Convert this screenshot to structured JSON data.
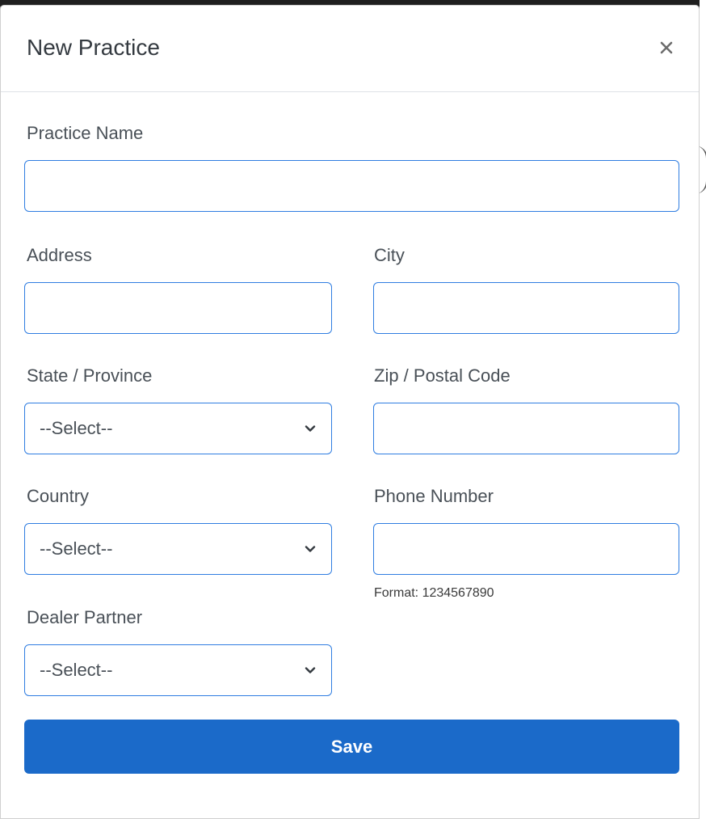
{
  "modal": {
    "title": "New Practice"
  },
  "fields": {
    "practice_name": {
      "label": "Practice Name",
      "value": "",
      "placeholder": ""
    },
    "address": {
      "label": "Address",
      "value": "",
      "placeholder": ""
    },
    "city": {
      "label": "City",
      "value": "",
      "placeholder": ""
    },
    "state": {
      "label": "State / Province",
      "selected": "--Select--"
    },
    "zip": {
      "label": "Zip / Postal Code",
      "value": "",
      "placeholder": ""
    },
    "country": {
      "label": "Country",
      "selected": "--Select--"
    },
    "phone": {
      "label": "Phone Number",
      "value": "",
      "placeholder": "",
      "hint": "Format: 1234567890"
    },
    "dealer": {
      "label": "Dealer Partner",
      "selected": "--Select--"
    }
  },
  "actions": {
    "save_label": "Save"
  },
  "colors": {
    "primary": "#1b6ac9",
    "input_border": "#2f7de1",
    "label": "#495057"
  },
  "icons": {
    "close": "close-icon",
    "select_chevron": "chevron-down-icon"
  }
}
